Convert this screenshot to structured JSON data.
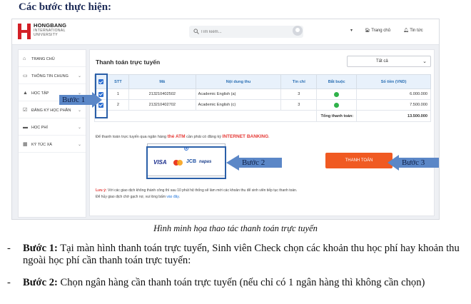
{
  "heading": "Các bước thực hiện:",
  "screenshot": {
    "logo": {
      "brand": "HONGBANG",
      "line2": "INTERNATIONAL",
      "line3": "UNIVERSITY"
    },
    "search_placeholder": "Tìm kiếm...",
    "top_links": {
      "home": "Trang chủ",
      "news": "Tin tức"
    },
    "sidebar": [
      {
        "label": "TRANG CHỦ",
        "icon": "home-icon",
        "has_chevron": false
      },
      {
        "label": "THÔNG TIN CHUNG",
        "icon": "monitor-icon",
        "has_chevron": true
      },
      {
        "label": "HỌC TẬP",
        "icon": "graduation-cap-icon",
        "has_chevron": true
      },
      {
        "label": "ĐĂNG KÝ HỌC PHẦN",
        "icon": "checkbox-icon",
        "has_chevron": true
      },
      {
        "label": "HỌC PHÍ",
        "icon": "card-icon",
        "has_chevron": true
      },
      {
        "label": "KÝ TÚC XÁ",
        "icon": "building-icon",
        "has_chevron": true
      }
    ],
    "panel_title": "Thanh toán trực tuyến",
    "filter_select": "Tất cả",
    "table": {
      "headers": [
        "",
        "STT",
        "Mã",
        "Nội dung thu",
        "Tín chỉ",
        "Bắt buộc",
        "Số tiền (VND)"
      ],
      "rows": [
        {
          "stt": "1",
          "code": "213210402502",
          "content": "Academic English (a)",
          "credits": "3",
          "required": true,
          "amount": "6.000.000"
        },
        {
          "stt": "2",
          "code": "213210402702",
          "content": "Academic English (c)",
          "credits": "3",
          "required": true,
          "amount": "7.500.000"
        }
      ],
      "total_label": "Tổng thanh toán:",
      "total_value": "13.500.000"
    },
    "note": {
      "before": "Để thanh toán trực tuyến qua ngân hàng ",
      "atm": "thẻ ATM",
      "middle": " cần phải có đăng ký ",
      "banking": "INTERNET BANKING",
      "after": "."
    },
    "bank_logos": {
      "visa": "VISA",
      "jcb": "JCB",
      "napas": "napas"
    },
    "pay_button": "THANH TOÁN",
    "footer": {
      "lead": "Lưu ý:",
      "line1": " Với các giao dịch không thành công thì sau 10 phút hệ thống sẽ làm mới các khoản thu để sinh viên tiếp tục thanh toán.",
      "line2_before": "Để hủy giao dịch chờ gạch nợ, vui lòng bấm ",
      "line2_link": "vào đây",
      "line2_after": "."
    },
    "callouts": [
      "Bước 1",
      "Bước 2",
      "Bước 3"
    ],
    "colors": {
      "accent": "#2d6fd3",
      "pay": "#f05a22",
      "callout": "#5b87c7",
      "alert": "#e53935"
    }
  },
  "caption": "Hình minh họa thao tác thanh toán trực tuyến",
  "steps": [
    {
      "bullet": "-",
      "label": "Bước 1:",
      "text": " Tại màn hình thanh toán trực tuyến, Sinh viên Check chọn các khoản thu học phí hay khoản thu ngoài học phí cần thanh toán trực tuyến:"
    },
    {
      "bullet": "-",
      "label": "Bước 2:",
      "text": " Chọn ngân hàng cần thanh toán trực tuyến (nếu chỉ có 1 ngân hàng thì không cần chọn)"
    }
  ]
}
